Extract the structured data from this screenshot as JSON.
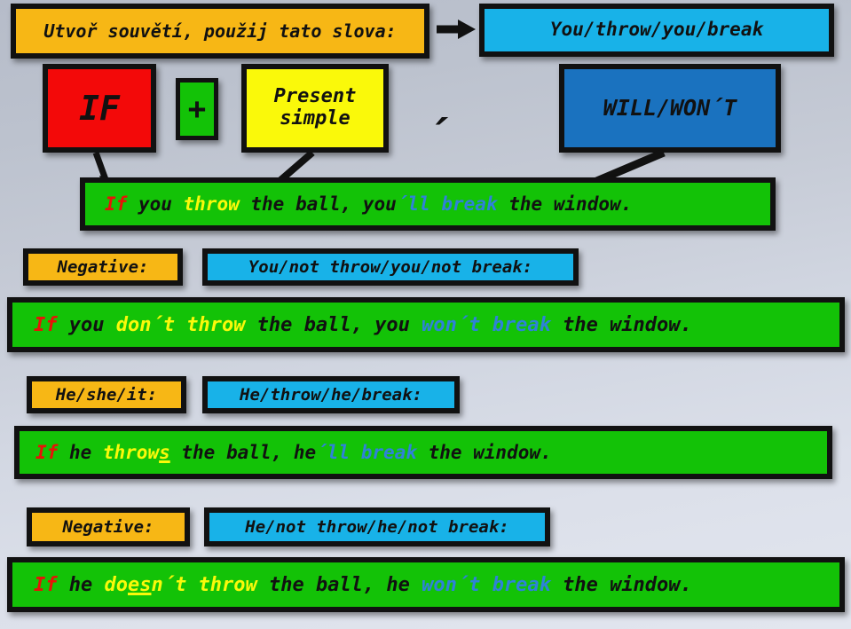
{
  "slide": {
    "background_top": "#b6bcc9",
    "background_bottom": "#e2e6ef",
    "colors": {
      "orange": "#f7b715",
      "light_blue": "#18b2e8",
      "dark_blue": "#1a72bf",
      "red": "#f30909",
      "green": "#13c207",
      "yellow": "#faf90a",
      "word_if_red": "#e81208",
      "word_condition_yellow": "#faf90a",
      "word_result_blue": "#2f82d8",
      "outline": "#111111"
    }
  },
  "header": {
    "instruction": "Utvoř souvětí, použij tato slova:",
    "arrow_icon": "arrow-right-icon",
    "words": "You/throw/you/break"
  },
  "formula": {
    "if_label": "IF",
    "plus_label": "+",
    "present_simple_label": "Present simple",
    "comma": "´",
    "will_wont_label": "WILL/WON´T"
  },
  "examples": [
    {
      "id": "affirmative-you",
      "label": null,
      "pattern": null,
      "parts": [
        {
          "text": "If",
          "color": "red"
        },
        {
          "text": " you ",
          "color": "black"
        },
        {
          "text": "throw",
          "color": "yellow"
        },
        {
          "text": " the ball, you",
          "color": "black"
        },
        {
          "text": "´ll break",
          "color": "blue"
        },
        {
          "text": " the window.",
          "color": "black"
        }
      ]
    },
    {
      "id": "negative-you",
      "label": "Negative:",
      "pattern": "You/not throw/you/not break:",
      "parts": [
        {
          "text": "If",
          "color": "red"
        },
        {
          "text": " you ",
          "color": "black"
        },
        {
          "text": "don´t throw",
          "color": "yellow"
        },
        {
          "text": " the ball, you ",
          "color": "black"
        },
        {
          "text": "won´t break",
          "color": "blue"
        },
        {
          "text": " the window.",
          "color": "black"
        }
      ]
    },
    {
      "id": "affirmative-he",
      "label": "He/she/it:",
      "pattern": "He/throw/he/break:",
      "parts": [
        {
          "text": "If",
          "color": "red"
        },
        {
          "text": " he ",
          "color": "black"
        },
        {
          "text": "throw",
          "color": "yellow"
        },
        {
          "text": "s",
          "color": "yellow",
          "underline": true
        },
        {
          "text": " the ball, he",
          "color": "black"
        },
        {
          "text": "´ll break",
          "color": "blue"
        },
        {
          "text": " the window.",
          "color": "black"
        }
      ]
    },
    {
      "id": "negative-he",
      "label": "Negative:",
      "pattern": "He/not throw/he/not break:",
      "parts": [
        {
          "text": "If",
          "color": "red"
        },
        {
          "text": " he ",
          "color": "black"
        },
        {
          "text": "do",
          "color": "yellow"
        },
        {
          "text": "es",
          "color": "yellow",
          "underline": true
        },
        {
          "text": "n´t throw",
          "color": "yellow"
        },
        {
          "text": " the ball, he ",
          "color": "black"
        },
        {
          "text": "won´t break",
          "color": "blue"
        },
        {
          "text": " the window.",
          "color": "black"
        }
      ]
    }
  ],
  "arrows": [
    {
      "name": "arrow-if-to-sentence"
    },
    {
      "name": "arrow-present-simple-to-sentence"
    },
    {
      "name": "arrow-will-wont-to-sentence"
    },
    {
      "name": "arrow-instruction-to-words"
    }
  ]
}
